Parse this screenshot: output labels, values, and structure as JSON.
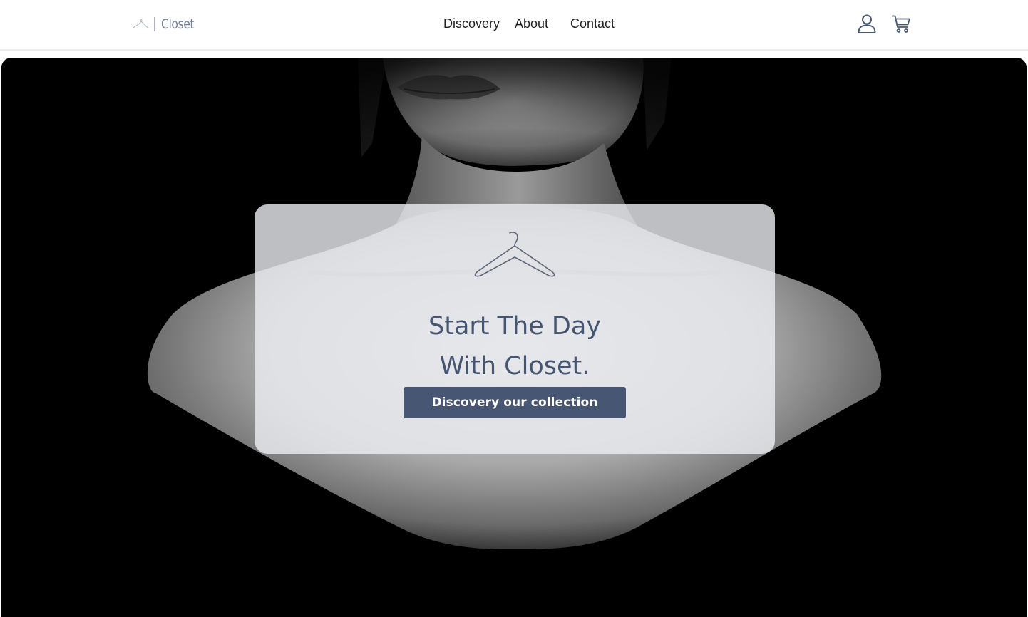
{
  "header": {
    "logo_text": "Closet",
    "nav": [
      {
        "label": "Discovery"
      },
      {
        "label": "About"
      },
      {
        "label": "Contact"
      }
    ],
    "icons": {
      "account": "user-icon",
      "cart": "cart-icon"
    }
  },
  "hero": {
    "title_line1": "Start The Day",
    "title_line2": "With Closet.",
    "cta_label": "Discovery our collection",
    "icon": "hanger-icon"
  },
  "colors": {
    "brand": "#475672",
    "title": "#455572",
    "logo": "#6f7f98",
    "nav_text": "#222222"
  }
}
